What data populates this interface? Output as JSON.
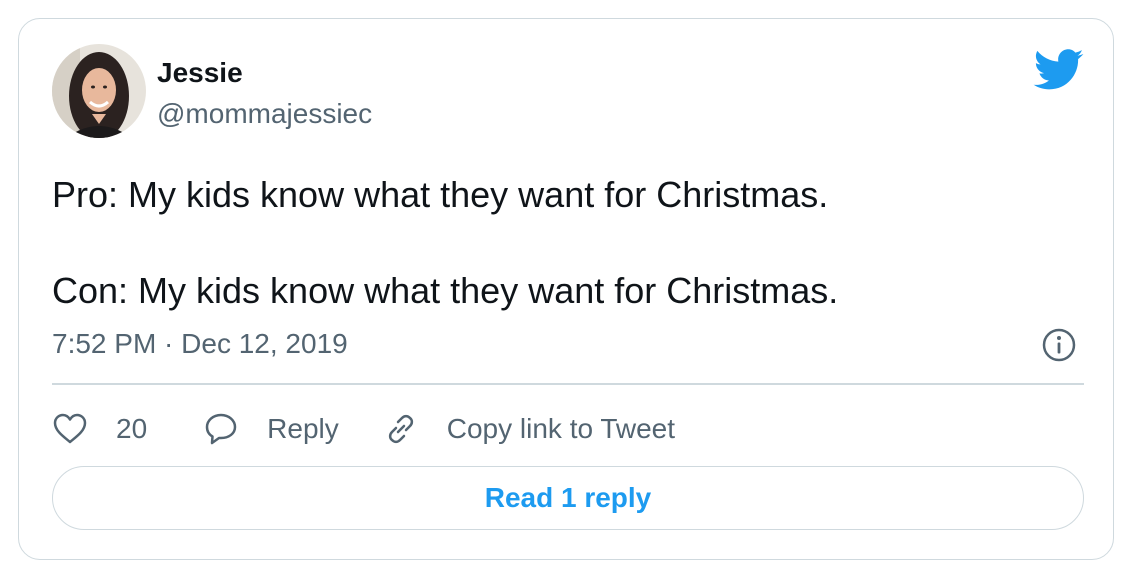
{
  "author": {
    "display_name": "Jessie",
    "handle": "@mommajessiec",
    "avatar_icon": "profile-photo"
  },
  "tweet": {
    "lines": [
      "Pro: My kids know what they want for Christmas.",
      "",
      "Con: My kids know what they want for Christmas."
    ],
    "timestamp": "7:52 PM · Dec 12, 2019"
  },
  "actions": {
    "like_count": "20",
    "reply_label": "Reply",
    "copy_link_label": "Copy link to Tweet"
  },
  "read_replies_label": "Read 1 reply",
  "icons": {
    "brand": "twitter-bird-icon",
    "info": "info-icon",
    "like": "heart-icon",
    "reply": "speech-bubble-icon",
    "copy": "link-icon"
  },
  "colors": {
    "brand_blue": "#1d9bf0",
    "text_primary": "#0f1419",
    "text_secondary": "#536471",
    "border": "#cfd9de"
  }
}
